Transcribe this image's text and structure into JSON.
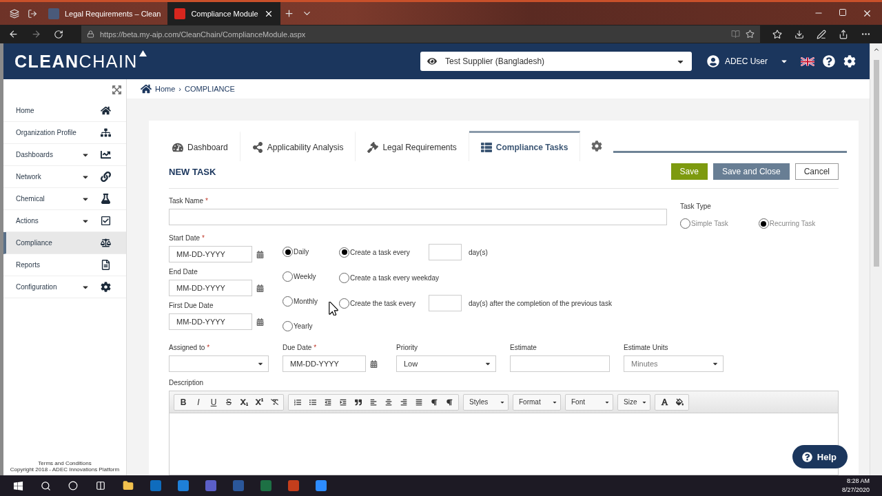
{
  "browser": {
    "tabs": [
      {
        "title": "Legal Requirements – Clean",
        "selected": false
      },
      {
        "title": "Compliance Module",
        "selected": true
      }
    ],
    "url": "https://beta.my-aip.com/CleanChain/ComplianceModule.aspx"
  },
  "header": {
    "logo": "**CLEAN**CHAIN",
    "supplier": "Test Supplier (Bangladesh)",
    "user": "ADEC User"
  },
  "sidebar": {
    "items": [
      {
        "label": "Home",
        "has_submenu": false,
        "selected": false
      },
      {
        "label": "Organization Profile",
        "has_submenu": false,
        "selected": false
      },
      {
        "label": "Dashboards",
        "has_submenu": true,
        "selected": false
      },
      {
        "label": "Network",
        "has_submenu": true,
        "selected": false
      },
      {
        "label": "Chemical",
        "has_submenu": true,
        "selected": false
      },
      {
        "label": "Actions",
        "has_submenu": true,
        "selected": false
      },
      {
        "label": "Compliance",
        "has_submenu": false,
        "selected": true
      },
      {
        "label": "Reports",
        "has_submenu": false,
        "selected": false
      },
      {
        "label": "Configuration",
        "has_submenu": true,
        "selected": false
      }
    ],
    "footer": [
      "Terms and Conditions",
      "Copyright 2018 - ADEC Innovations Platform"
    ]
  },
  "breadcrumb": {
    "items": [
      "Home",
      "COMPLIANCE"
    ],
    "separator": "›"
  },
  "tabs": [
    {
      "label": "Dashboard",
      "selected": false
    },
    {
      "label": "Applicability Analysis",
      "selected": false
    },
    {
      "label": "Legal Requirements",
      "selected": false
    },
    {
      "label": "Compliance Tasks",
      "selected": true
    }
  ],
  "form": {
    "title": "NEW TASK",
    "buttons": [
      {
        "label": "Save",
        "kind": "primary"
      },
      {
        "label": "Save and Close",
        "kind": "secondary"
      },
      {
        "label": "Cancel",
        "kind": "plain"
      }
    ],
    "task_name": {
      "label": "Task Name",
      "required_mark": "*"
    },
    "task_type": {
      "label": "Task Type",
      "options": [
        {
          "label": "Simple Task",
          "selected": false
        },
        {
          "label": "Recurring Task",
          "selected": true
        }
      ]
    },
    "dates": [
      {
        "label": "Start Date",
        "required_mark": "*",
        "placeholder": "MM-DD-YYYY"
      },
      {
        "label": "End Date",
        "placeholder": "MM-DD-YYYY"
      },
      {
        "label": "First Due Date",
        "placeholder": "MM-DD-YYYY"
      }
    ],
    "frequency": [
      {
        "label": "Daily",
        "selected": true
      },
      {
        "label": "Weekly",
        "selected": false
      },
      {
        "label": "Monthly",
        "selected": false
      },
      {
        "label": "Yearly",
        "selected": false
      }
    ],
    "recurrence": [
      {
        "kind": "interval",
        "before": "Create a task every",
        "after": "day(s)",
        "selected": true
      },
      {
        "kind": "plain",
        "before": "Create a task every weekday",
        "selected": false
      },
      {
        "kind": "interval",
        "before": "Create the task every",
        "after": "day(s) after the completion of the previous task",
        "selected": false
      }
    ],
    "details": [
      {
        "kind": "select",
        "label": "Assigned to",
        "required_mark": "*"
      },
      {
        "kind": "date",
        "label": "Due Date",
        "required_mark": "*",
        "placeholder": "MM-DD-YYYY"
      },
      {
        "kind": "select",
        "label": "Priority",
        "value": "Low"
      },
      {
        "kind": "text",
        "label": "Estimate"
      },
      {
        "kind": "select",
        "label": "Estimate Units",
        "value": "Minutes"
      }
    ],
    "description": {
      "label": "Description",
      "letters": [
        "B",
        "I",
        "U",
        "S"
      ],
      "dropdowns": [
        "Styles",
        "Format",
        "Font",
        "Size"
      ]
    }
  },
  "help": "Help",
  "taskbar": {
    "time": "8:28 AM",
    "date": "8/27/2020"
  }
}
